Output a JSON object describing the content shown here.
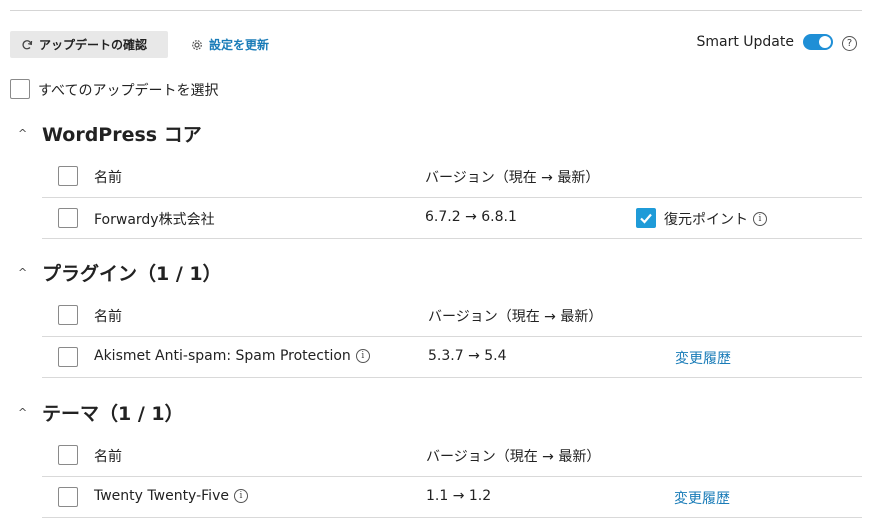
{
  "toolbar": {
    "check_updates_label": "アップデートの確認",
    "check_updates_icon": "refresh-icon",
    "settings_label": "設定を更新",
    "settings_icon": "gear-icon",
    "smart_update_label": "Smart Update",
    "smart_update_on": true,
    "help_icon_text": "?"
  },
  "select_all_label": "すべてのアップデートを選択",
  "sections": {
    "core": {
      "title": "WordPress コア",
      "header": {
        "name": "名前",
        "version": "バージョン（現在 → 最新）"
      },
      "rows": [
        {
          "name": "Forwardy株式会社",
          "version": "6.7.2 → 6.8.1",
          "restore_label": "復元ポイント",
          "restore_checked": true
        }
      ]
    },
    "plugins": {
      "title": "プラグイン（1 / 1）",
      "header": {
        "name": "名前",
        "version": "バージョン（現在 → 最新）"
      },
      "rows": [
        {
          "name": "Akismet Anti-spam: Spam Protection",
          "version": "5.3.7 → 5.4",
          "changelog": "変更履歴"
        }
      ]
    },
    "themes": {
      "title": "テーマ（1 / 1）",
      "header": {
        "name": "名前",
        "version": "バージョン（現在 → 最新）"
      },
      "rows": [
        {
          "name": "Twenty Twenty-Five",
          "version": "1.1 → 1.2",
          "changelog": "変更履歴"
        }
      ]
    }
  },
  "colors": {
    "accent": "#1f9bd8",
    "link": "#1a7cb8",
    "button_bg": "#e8e8e8"
  }
}
